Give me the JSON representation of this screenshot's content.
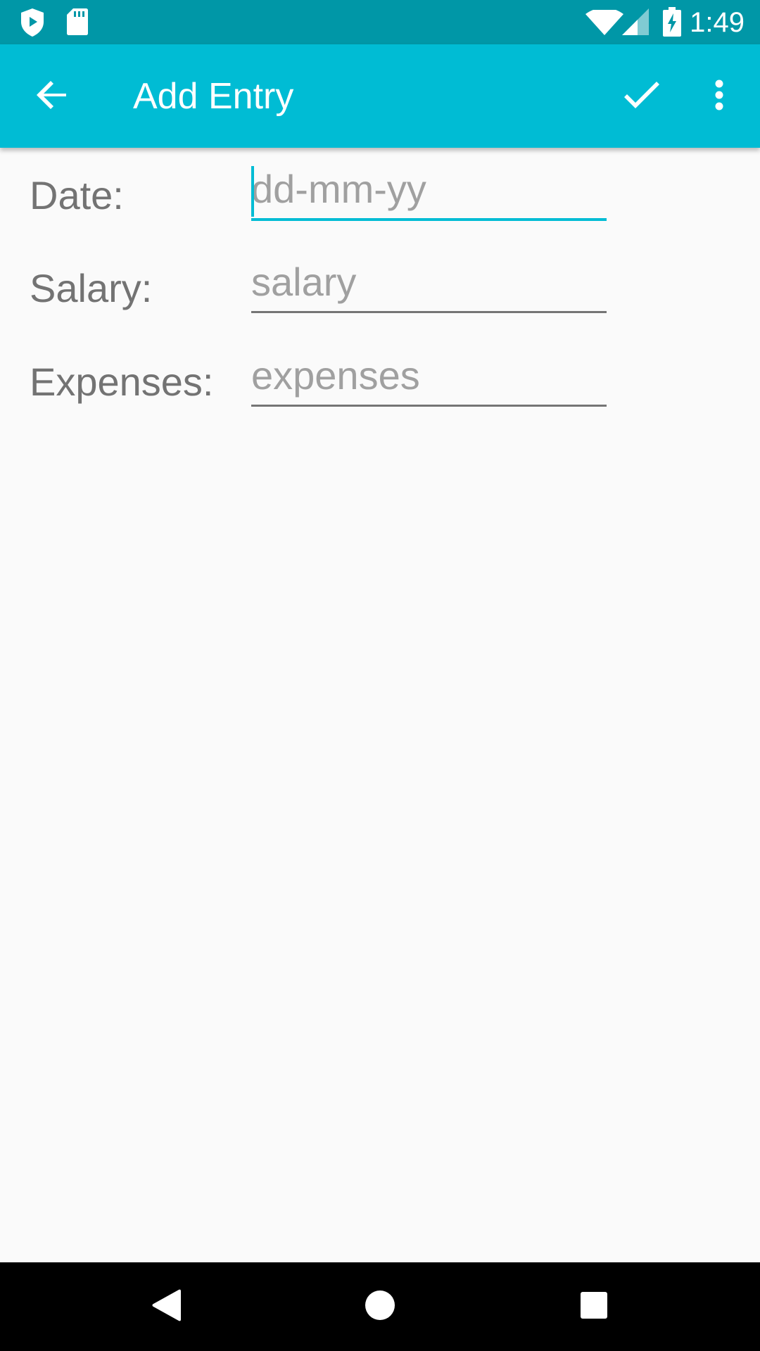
{
  "status_bar": {
    "time": "1:49",
    "left_icons": [
      "shield-play-icon",
      "sd-card-icon"
    ],
    "right_icons": [
      "wifi-icon",
      "cellular-signal-icon",
      "battery-charging-icon"
    ]
  },
  "app_bar": {
    "title": "Add Entry",
    "back_icon": "arrow-back-icon",
    "save_icon": "check-icon",
    "more_icon": "more-vert-icon",
    "color": "#00bcd4",
    "status_color": "#0097a7"
  },
  "form": {
    "date": {
      "label": "Date:",
      "placeholder": "dd-mm-yy",
      "value": "",
      "focused": true
    },
    "salary": {
      "label": "Salary:",
      "placeholder": "salary",
      "value": ""
    },
    "expenses": {
      "label": "Expenses:",
      "placeholder": "expenses",
      "value": ""
    }
  },
  "nav_bar": {
    "icons": [
      "nav-back-icon",
      "nav-home-icon",
      "nav-recents-icon"
    ]
  }
}
